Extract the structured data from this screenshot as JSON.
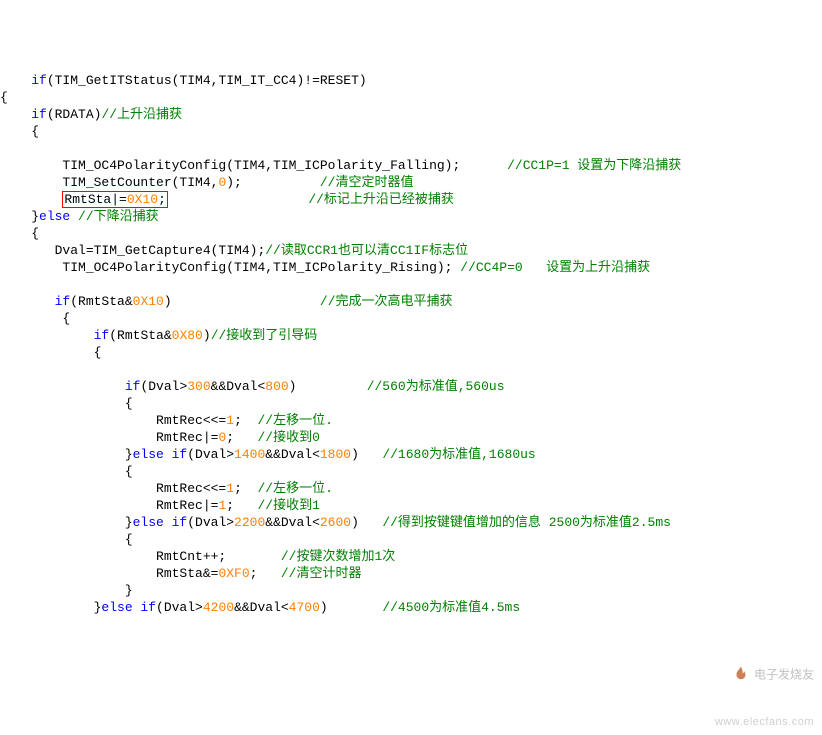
{
  "lines": {
    "l1_a": "    ",
    "l1_b": "if",
    "l1_c": "(TIM_GetITStatus(TIM4,TIM_IT_CC4)!=RESET)",
    "l2": "{",
    "l3_a": "    ",
    "l3_b": "if",
    "l3_c": "(RDATA)",
    "l3_d": "//上升沿捕获",
    "l4": "    {",
    "l5": "",
    "l6_a": "        TIM_OC4PolarityConfig(TIM4,TIM_ICPolarity_Falling);      ",
    "l6_b": "//CC1P=1 设置为下降沿捕获",
    "l7_a": "        TIM_SetCounter(TIM4,",
    "l7_b": "0",
    "l7_c": ");          ",
    "l7_d": "//清空定时器值",
    "l8_a": "        ",
    "l8_box_a": "RmtSta|=",
    "l8_box_b": "0X10",
    "l8_box_c": ";",
    "l8_c": "                  ",
    "l8_d": "//标记上升沿已经被捕获",
    "l9_a": "    }",
    "l9_b": "else ",
    "l9_c": "//下降沿捕获",
    "l10": "    {",
    "l11_a": "       Dval=TIM_GetCapture4(TIM4);",
    "l11_b": "//读取CCR1也可以清CC1IF标志位",
    "l12_a": "        TIM_OC4PolarityConfig(TIM4,TIM_ICPolarity_Rising); ",
    "l12_b": "//CC4P=0   设置为上升沿捕获",
    "l13": "",
    "l14_a": "       ",
    "l14_b": "if",
    "l14_c": "(RmtSta&",
    "l14_d": "0X10",
    "l14_e": ")                   ",
    "l14_f": "//完成一次高电平捕获",
    "l15": "        {",
    "l16_a": "            ",
    "l16_b": "if",
    "l16_c": "(RmtSta&",
    "l16_d": "0X80",
    "l16_e": ")",
    "l16_f": "//接收到了引导码",
    "l17": "            {",
    "l18": "",
    "l19_a": "                ",
    "l19_b": "if",
    "l19_c": "(Dval>",
    "l19_d": "300",
    "l19_e": "&&Dval<",
    "l19_f": "800",
    "l19_g": ")         ",
    "l19_h": "//560为标准值,560us",
    "l20": "                {",
    "l21_a": "                    RmtRec<<=",
    "l21_b": "1",
    "l21_c": ";  ",
    "l21_d": "//左移一位.",
    "l22_a": "                    RmtRec|=",
    "l22_b": "0",
    "l22_c": ";   ",
    "l22_d": "//接收到0",
    "l23_a": "                }",
    "l23_b": "else if",
    "l23_c": "(Dval>",
    "l23_d": "1400",
    "l23_e": "&&Dval<",
    "l23_f": "1800",
    "l23_g": ")   ",
    "l23_h": "//1680为标准值,1680us",
    "l24": "                {",
    "l25_a": "                    RmtRec<<=",
    "l25_b": "1",
    "l25_c": ";  ",
    "l25_d": "//左移一位.",
    "l26_a": "                    RmtRec|=",
    "l26_b": "1",
    "l26_c": ";   ",
    "l26_d": "//接收到1",
    "l27_a": "                }",
    "l27_b": "else if",
    "l27_c": "(Dval>",
    "l27_d": "2200",
    "l27_e": "&&Dval<",
    "l27_f": "2600",
    "l27_g": ")   ",
    "l27_h": "//得到按键键值增加的信息 2500为标准值2.5ms",
    "l28": "                {",
    "l29_a": "                    RmtCnt++;       ",
    "l29_b": "//按键次数增加1次",
    "l30_a": "                    RmtSta&=",
    "l30_b": "0XF0",
    "l30_c": ";   ",
    "l30_d": "//清空计时器",
    "l31": "                }",
    "l32_a": "            }",
    "l32_b": "else if",
    "l32_c": "(Dval>",
    "l32_d": "4200",
    "l32_e": "&&Dval<",
    "l32_f": "4700",
    "l32_g": ")       ",
    "l32_h": "//4500为标准值4.5ms"
  },
  "watermark": {
    "brand": "电子发烧友",
    "url": "www.elecfans.com"
  }
}
